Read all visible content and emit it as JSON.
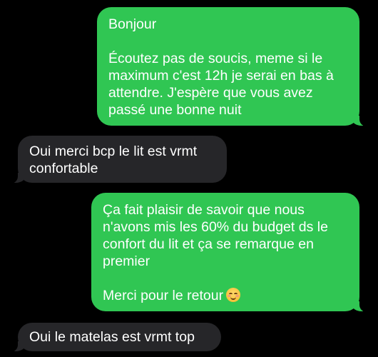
{
  "messages": [
    {
      "direction": "sent",
      "paragraphs": [
        "Bonjour",
        "Écoutez pas de soucis, meme si le\nmaximum c'est 12h je serai en bas à\nattendre. J'espère que vous avez\npassé une bonne nuit"
      ]
    },
    {
      "direction": "received",
      "text": "Oui merci bcp le lit est vrmt\nconfortable"
    },
    {
      "direction": "sent",
      "paragraphs": [
        "Ça fait plaisir de savoir que nous\nn'avons mis les 60% du budget ds le\nconfort du lit et ça se remarque en\npremier",
        "Merci pour le retour"
      ],
      "emoji": "smiling-face-with-blush"
    },
    {
      "direction": "received",
      "text": "Oui le matelas est vrmt top"
    }
  ],
  "colors": {
    "background": "#000000",
    "sent_bubble": "#30c653",
    "received_bubble": "#262629",
    "text": "#ffffff"
  }
}
